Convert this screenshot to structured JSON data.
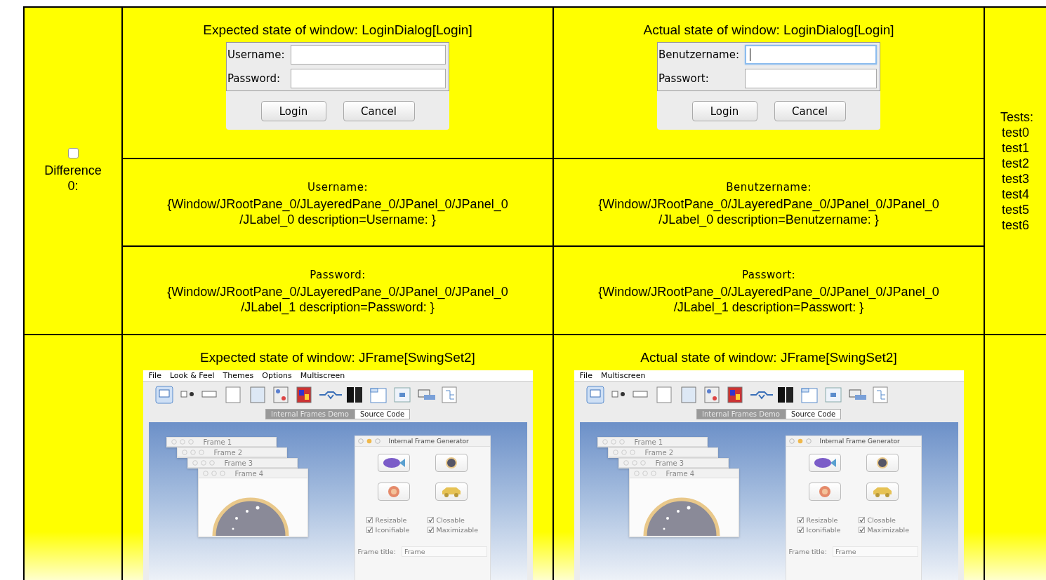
{
  "difference": {
    "checked": false,
    "label": "Difference 0:"
  },
  "dialogs": [
    {
      "heading": "Expected state of window: LoginDialog[Login]",
      "fields": [
        {
          "label": "Username:",
          "focused": false
        },
        {
          "label": "Password:",
          "focused": false
        }
      ],
      "buttons": [
        "Login",
        "Cancel"
      ]
    },
    {
      "heading": "Actual state of window: LoginDialog[Login]",
      "fields": [
        {
          "label": "Benutzername:",
          "focused": true
        },
        {
          "label": "Passwort:",
          "focused": false
        }
      ],
      "buttons": [
        "Login",
        "Cancel"
      ]
    }
  ],
  "component_rows": [
    [
      {
        "name": "Username:",
        "path": "{Window/JRootPane_0/JLayeredPane_0/JPanel_0/JPanel_0\n/JLabel_0 description=Username: }"
      },
      {
        "name": "Benutzername:",
        "path": "{Window/JRootPane_0/JLayeredPane_0/JPanel_0/JPanel_0\n/JLabel_0 description=Benutzername: }"
      }
    ],
    [
      {
        "name": "Password:",
        "path": "{Window/JRootPane_0/JLayeredPane_0/JPanel_0/JPanel_0\n/JLabel_1 description=Password: }"
      },
      {
        "name": "Passwort:",
        "path": "{Window/JRootPane_0/JLayeredPane_0/JPanel_0/JPanel_0\n/JLabel_1 description=Passwort: }"
      }
    ]
  ],
  "tests": {
    "heading": "Tests:",
    "items": [
      "test0",
      "test1",
      "test2",
      "test3",
      "test4",
      "test5",
      "test6"
    ]
  },
  "frames": [
    {
      "heading": "Expected state of window: JFrame[SwingSet2]",
      "menu": [
        "File",
        "Look & Feel",
        "Themes",
        "Options",
        "Multiscreen"
      ],
      "tabs": [
        {
          "label": "Internal Frames Demo",
          "selected": true
        },
        {
          "label": "Source Code",
          "selected": false
        }
      ],
      "internal_frames": [
        "Frame 1",
        "Frame 2",
        "Frame 3",
        "Frame 4"
      ],
      "generator": {
        "title": "Internal Frame Generator",
        "options": [
          {
            "label": "Resizable",
            "checked": true
          },
          {
            "label": "Closable",
            "checked": true
          },
          {
            "label": "Iconifiable",
            "checked": true
          },
          {
            "label": "Maximizable",
            "checked": true
          }
        ],
        "frame_title_label": "Frame title:",
        "frame_title_value": "Frame"
      }
    },
    {
      "heading": "Actual state of window: JFrame[SwingSet2]",
      "menu": [
        "File",
        "Multiscreen"
      ],
      "tabs": [
        {
          "label": "Internal Frames Demo",
          "selected": true
        },
        {
          "label": "Source Code",
          "selected": false
        }
      ],
      "internal_frames": [
        "Frame 1",
        "Frame 2",
        "Frame 3",
        "Frame 4"
      ],
      "generator": {
        "title": "Internal Frame Generator",
        "options": [
          {
            "label": "Resizable",
            "checked": true
          },
          {
            "label": "Closable",
            "checked": true
          },
          {
            "label": "Iconifiable",
            "checked": true
          },
          {
            "label": "Maximizable",
            "checked": true
          }
        ],
        "frame_title_label": "Frame title:",
        "frame_title_value": "Frame"
      }
    }
  ]
}
